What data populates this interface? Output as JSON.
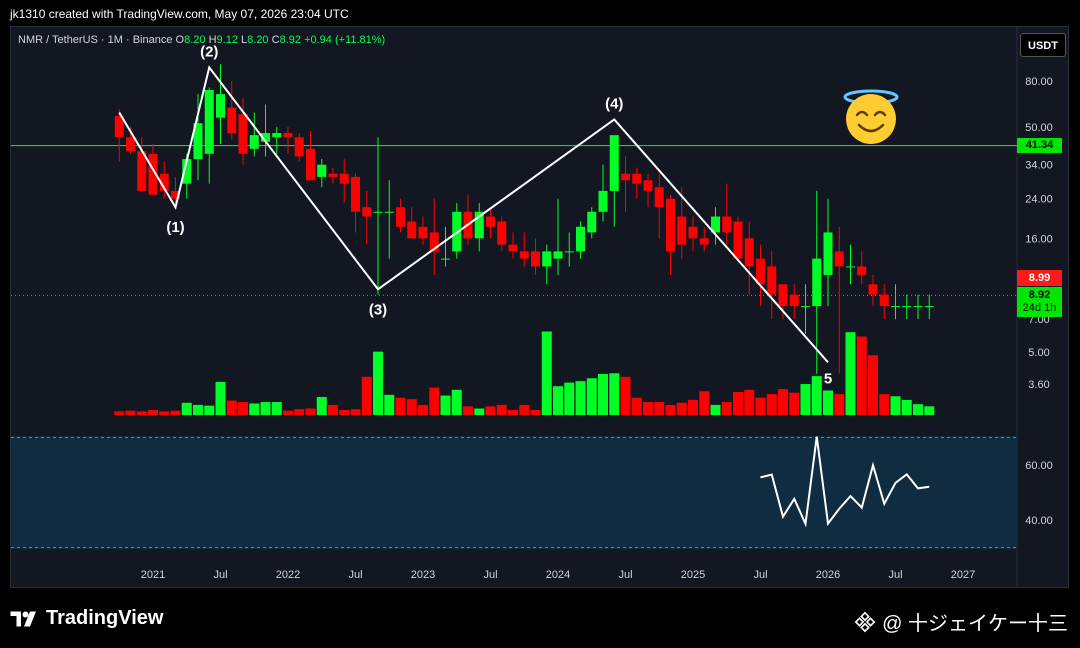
{
  "caption": "jk1310 created with TradingView.com, May 07, 2026 23:04 UTC",
  "symbol": {
    "title": "NMR / TetherUS · 1M · Binance",
    "o_label": "O",
    "o": "8.20",
    "h_label": "H",
    "h": "9.12",
    "l_label": "L",
    "l": "8.20",
    "c_label": "C",
    "c": "8.92",
    "change": "+0.94 (+11.81%)"
  },
  "currency_button": "USDT",
  "price_labels": {
    "hline": "41.34",
    "prev_close": "8.99",
    "last": "8.92",
    "countdown": "24d 1h"
  },
  "footer": {
    "brand": "TradingView",
    "right_text": "@ 十ジェイケー十三"
  },
  "colors": {
    "up": "#00ff26",
    "down": "#ff0000",
    "bg": "#131722",
    "hline": "#00e600",
    "wave": "#ffffff"
  },
  "chart_data": {
    "type": "candlestick",
    "y_scale": "log",
    "y_ticks": [
      "80.00",
      "50.00",
      "34.00",
      "24.00",
      "16.00",
      "7.00",
      "5.00",
      "3.60"
    ],
    "x_ticks": [
      "2021",
      "Jul",
      "2022",
      "Jul",
      "2023",
      "Jul",
      "2024",
      "Jul",
      "2025",
      "Jul",
      "2026",
      "Jul",
      "2027"
    ],
    "horizontal_line": 41.34,
    "last_price": 8.92,
    "candles": [
      {
        "t": "2020-10",
        "o": 56,
        "h": 60,
        "l": 35,
        "c": 45
      },
      {
        "t": "2020-11",
        "o": 45,
        "h": 50,
        "l": 38,
        "c": 39
      },
      {
        "t": "2020-12",
        "o": 39,
        "h": 45,
        "l": 28,
        "c": 26
      },
      {
        "t": "2021-01",
        "o": 38,
        "h": 42,
        "l": 25,
        "c": 25
      },
      {
        "t": "2021-02",
        "o": 31,
        "h": 35,
        "l": 24,
        "c": 26
      },
      {
        "t": "2021-03",
        "o": 26,
        "h": 30,
        "l": 23,
        "c": 24
      },
      {
        "t": "2021-04",
        "o": 28,
        "h": 38,
        "l": 24,
        "c": 36
      },
      {
        "t": "2021-05",
        "o": 36,
        "h": 70,
        "l": 29,
        "c": 52
      },
      {
        "t": "2021-06",
        "o": 38,
        "h": 75,
        "l": 28,
        "c": 73
      },
      {
        "t": "2021-07",
        "o": 55,
        "h": 95,
        "l": 42,
        "c": 70
      },
      {
        "t": "2021-08",
        "o": 61,
        "h": 80,
        "l": 44,
        "c": 47
      },
      {
        "t": "2021-09",
        "o": 57,
        "h": 67,
        "l": 34,
        "c": 38
      },
      {
        "t": "2021-10",
        "o": 40,
        "h": 58,
        "l": 37,
        "c": 46
      },
      {
        "t": "2021-11",
        "o": 43,
        "h": 63,
        "l": 37,
        "c": 47
      },
      {
        "t": "2021-12",
        "o": 45,
        "h": 50,
        "l": 38,
        "c": 47
      },
      {
        "t": "2022-01",
        "o": 47,
        "h": 50,
        "l": 38,
        "c": 45
      },
      {
        "t": "2022-02",
        "o": 45,
        "h": 47,
        "l": 35,
        "c": 37
      },
      {
        "t": "2022-03",
        "o": 40,
        "h": 48,
        "l": 30,
        "c": 29
      },
      {
        "t": "2022-04",
        "o": 30,
        "h": 36,
        "l": 27,
        "c": 34
      },
      {
        "t": "2022-05",
        "o": 31,
        "h": 33,
        "l": 28,
        "c": 30
      },
      {
        "t": "2022-06",
        "o": 31,
        "h": 36,
        "l": 23,
        "c": 28
      },
      {
        "t": "2022-07",
        "o": 30,
        "h": 31,
        "l": 17,
        "c": 21
      },
      {
        "t": "2022-08",
        "o": 22,
        "h": 26,
        "l": 15,
        "c": 20
      },
      {
        "t": "2022-09",
        "o": 21,
        "h": 45,
        "l": 9,
        "c": 21
      },
      {
        "t": "2022-10",
        "o": 21,
        "h": 29,
        "l": 13,
        "c": 21
      },
      {
        "t": "2022-11",
        "o": 22,
        "h": 24,
        "l": 17,
        "c": 18
      },
      {
        "t": "2022-12",
        "o": 19,
        "h": 22,
        "l": 16,
        "c": 16
      },
      {
        "t": "2023-01",
        "o": 18,
        "h": 20,
        "l": 15,
        "c": 16
      },
      {
        "t": "2023-02",
        "o": 17,
        "h": 24,
        "l": 11,
        "c": 14
      },
      {
        "t": "2023-03",
        "o": 13,
        "h": 18,
        "l": 12,
        "c": 13
      },
      {
        "t": "2023-04",
        "o": 14,
        "h": 23,
        "l": 13,
        "c": 21
      },
      {
        "t": "2023-05",
        "o": 21,
        "h": 25,
        "l": 15,
        "c": 16
      },
      {
        "t": "2023-06",
        "o": 16,
        "h": 23,
        "l": 14,
        "c": 21
      },
      {
        "t": "2023-07",
        "o": 20,
        "h": 22,
        "l": 16,
        "c": 18
      },
      {
        "t": "2023-08",
        "o": 19,
        "h": 20,
        "l": 14,
        "c": 15
      },
      {
        "t": "2023-09",
        "o": 15,
        "h": 17,
        "l": 13,
        "c": 14
      },
      {
        "t": "2023-10",
        "o": 14,
        "h": 17,
        "l": 12,
        "c": 13
      },
      {
        "t": "2023-11",
        "o": 14,
        "h": 16,
        "l": 11,
        "c": 12
      },
      {
        "t": "2023-12",
        "o": 12,
        "h": 15,
        "l": 10,
        "c": 14
      },
      {
        "t": "2024-01",
        "o": 13,
        "h": 24,
        "l": 11,
        "c": 14
      },
      {
        "t": "2024-02",
        "o": 14,
        "h": 17,
        "l": 12,
        "c": 14
      },
      {
        "t": "2024-03",
        "o": 14,
        "h": 19,
        "l": 13,
        "c": 18
      },
      {
        "t": "2024-04",
        "o": 17,
        "h": 22,
        "l": 16,
        "c": 21
      },
      {
        "t": "2024-05",
        "o": 21,
        "h": 34,
        "l": 19,
        "c": 26
      },
      {
        "t": "2024-06",
        "o": 26,
        "h": 39,
        "l": 18,
        "c": 46
      },
      {
        "t": "2024-07",
        "o": 31,
        "h": 37,
        "l": 21,
        "c": 29
      },
      {
        "t": "2024-08",
        "o": 31,
        "h": 33,
        "l": 24,
        "c": 28
      },
      {
        "t": "2024-09",
        "o": 29,
        "h": 31,
        "l": 22,
        "c": 26
      },
      {
        "t": "2024-10",
        "o": 27,
        "h": 31,
        "l": 16,
        "c": 22
      },
      {
        "t": "2024-11",
        "o": 24,
        "h": 25,
        "l": 11,
        "c": 14
      },
      {
        "t": "2024-12",
        "o": 20,
        "h": 27,
        "l": 13,
        "c": 15
      },
      {
        "t": "2025-01",
        "o": 18,
        "h": 20,
        "l": 14,
        "c": 16
      },
      {
        "t": "2025-02",
        "o": 16,
        "h": 18,
        "l": 14,
        "c": 15
      },
      {
        "t": "2025-03",
        "o": 17,
        "h": 22,
        "l": 15,
        "c": 20
      },
      {
        "t": "2025-04",
        "o": 20,
        "h": 28,
        "l": 15,
        "c": 17
      },
      {
        "t": "2025-05",
        "o": 19,
        "h": 20,
        "l": 13,
        "c": 13
      },
      {
        "t": "2025-06",
        "o": 16,
        "h": 19,
        "l": 9,
        "c": 12
      },
      {
        "t": "2025-07",
        "o": 13,
        "h": 15,
        "l": 8,
        "c": 10
      },
      {
        "t": "2025-08",
        "o": 12,
        "h": 14,
        "l": 7,
        "c": 9
      },
      {
        "t": "2025-09",
        "o": 10,
        "h": 10,
        "l": 7,
        "c": 8
      },
      {
        "t": "2025-10",
        "o": 9,
        "h": 10,
        "l": 7,
        "c": 8
      },
      {
        "t": "2025-11",
        "o": 8,
        "h": 10,
        "l": 6,
        "c": 8
      },
      {
        "t": "2025-12",
        "o": 8,
        "h": 26,
        "l": 4,
        "c": 13
      },
      {
        "t": "2026-01",
        "o": 11,
        "h": 24,
        "l": 8,
        "c": 17
      },
      {
        "t": "2026-02",
        "o": 14,
        "h": 18,
        "l": 4,
        "c": 12
      },
      {
        "t": "2026-03",
        "o": 12,
        "h": 15,
        "l": 10,
        "c": 12
      },
      {
        "t": "2026-04",
        "o": 12,
        "h": 14,
        "l": 10,
        "c": 11
      },
      {
        "t": "2026-05",
        "o": 10,
        "h": 11,
        "l": 8,
        "c": 9
      },
      {
        "t": "2026-06",
        "o": 9,
        "h": 10,
        "l": 7,
        "c": 8
      },
      {
        "t": "2026-07",
        "o": 8,
        "h": 10,
        "l": 7,
        "c": 8
      },
      {
        "t": "2026-08",
        "o": 8,
        "h": 9,
        "l": 7,
        "c": 8
      },
      {
        "t": "2026-09",
        "o": 8,
        "h": 9,
        "l": 7,
        "c": 8
      },
      {
        "t": "2026-10",
        "o": 8,
        "h": 9,
        "l": 7,
        "c": 8
      }
    ],
    "volume_relative": [
      0.05,
      0.06,
      0.05,
      0.07,
      0.05,
      0.06,
      0.17,
      0.14,
      0.13,
      0.46,
      0.2,
      0.18,
      0.16,
      0.18,
      0.18,
      0.06,
      0.08,
      0.09,
      0.25,
      0.14,
      0.07,
      0.08,
      0.53,
      0.88,
      0.28,
      0.24,
      0.22,
      0.14,
      0.38,
      0.27,
      0.35,
      0.12,
      0.09,
      0.12,
      0.14,
      0.07,
      0.14,
      0.07,
      1.16,
      0.4,
      0.45,
      0.47,
      0.51,
      0.57,
      0.58,
      0.53,
      0.24,
      0.18,
      0.18,
      0.14,
      0.17,
      0.21,
      0.33,
      0.14,
      0.18,
      0.32,
      0.35,
      0.24,
      0.29,
      0.36,
      0.31,
      0.43,
      0.54,
      0.34,
      0.29,
      1.15,
      1.09,
      0.83,
      0.29,
      0.26,
      0.21,
      0.15,
      0.12,
      0.11,
      0.28,
      0.04
    ],
    "wave_labels": [
      "(1)",
      "(2)",
      "(3)",
      "(4)",
      "5"
    ],
    "wave_points": [
      {
        "t": "2020-10",
        "price": 58
      },
      {
        "t": "2021-03",
        "price": 22
      },
      {
        "t": "2021-06",
        "price": 92
      },
      {
        "t": "2022-09",
        "price": 9.5
      },
      {
        "t": "2024-06",
        "price": 54
      },
      {
        "t": "2026-01",
        "price": 4.5
      }
    ],
    "indicator": {
      "y_ticks": [
        "60.00",
        "40.00"
      ],
      "levels": [
        70,
        30
      ],
      "values": [
        55.5,
        56.5,
        41.2,
        47.7,
        38.6,
        70.3,
        38.7,
        44.1,
        48.7,
        44.5,
        59.9,
        45.9,
        53.5,
        56.6,
        51.5,
        52.1
      ]
    }
  }
}
